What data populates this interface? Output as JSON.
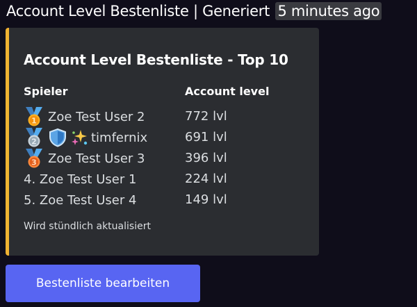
{
  "header": {
    "text": "Account Level Bestenliste | Generiert",
    "timestamp": "5 minutes ago"
  },
  "embed": {
    "accent_color": "#f0b232",
    "title": "Account Level Bestenliste - Top 10",
    "columns": {
      "player": "Spieler",
      "level": "Account level"
    },
    "rows": [
      {
        "rank_icon": "medal-1-icon",
        "name": "Zoe Test User 2",
        "level": "772 lvl"
      },
      {
        "rank_icon": "medal-2-icon",
        "badges": [
          "shield-icon",
          "sparkle-icon"
        ],
        "name": "timfernix",
        "level": "691 lvl"
      },
      {
        "rank_icon": "medal-3-icon",
        "name": "Zoe Test User 3",
        "level": "396 lvl"
      },
      {
        "name": "4. Zoe Test User 1",
        "level": "224 lvl"
      },
      {
        "name": "5. Zoe Test User 4",
        "level": "149 lvl"
      }
    ],
    "footer": "Wird stündlich aktualisiert"
  },
  "button": {
    "label": "Bestenliste bearbeiten",
    "color": "#5865f2"
  }
}
